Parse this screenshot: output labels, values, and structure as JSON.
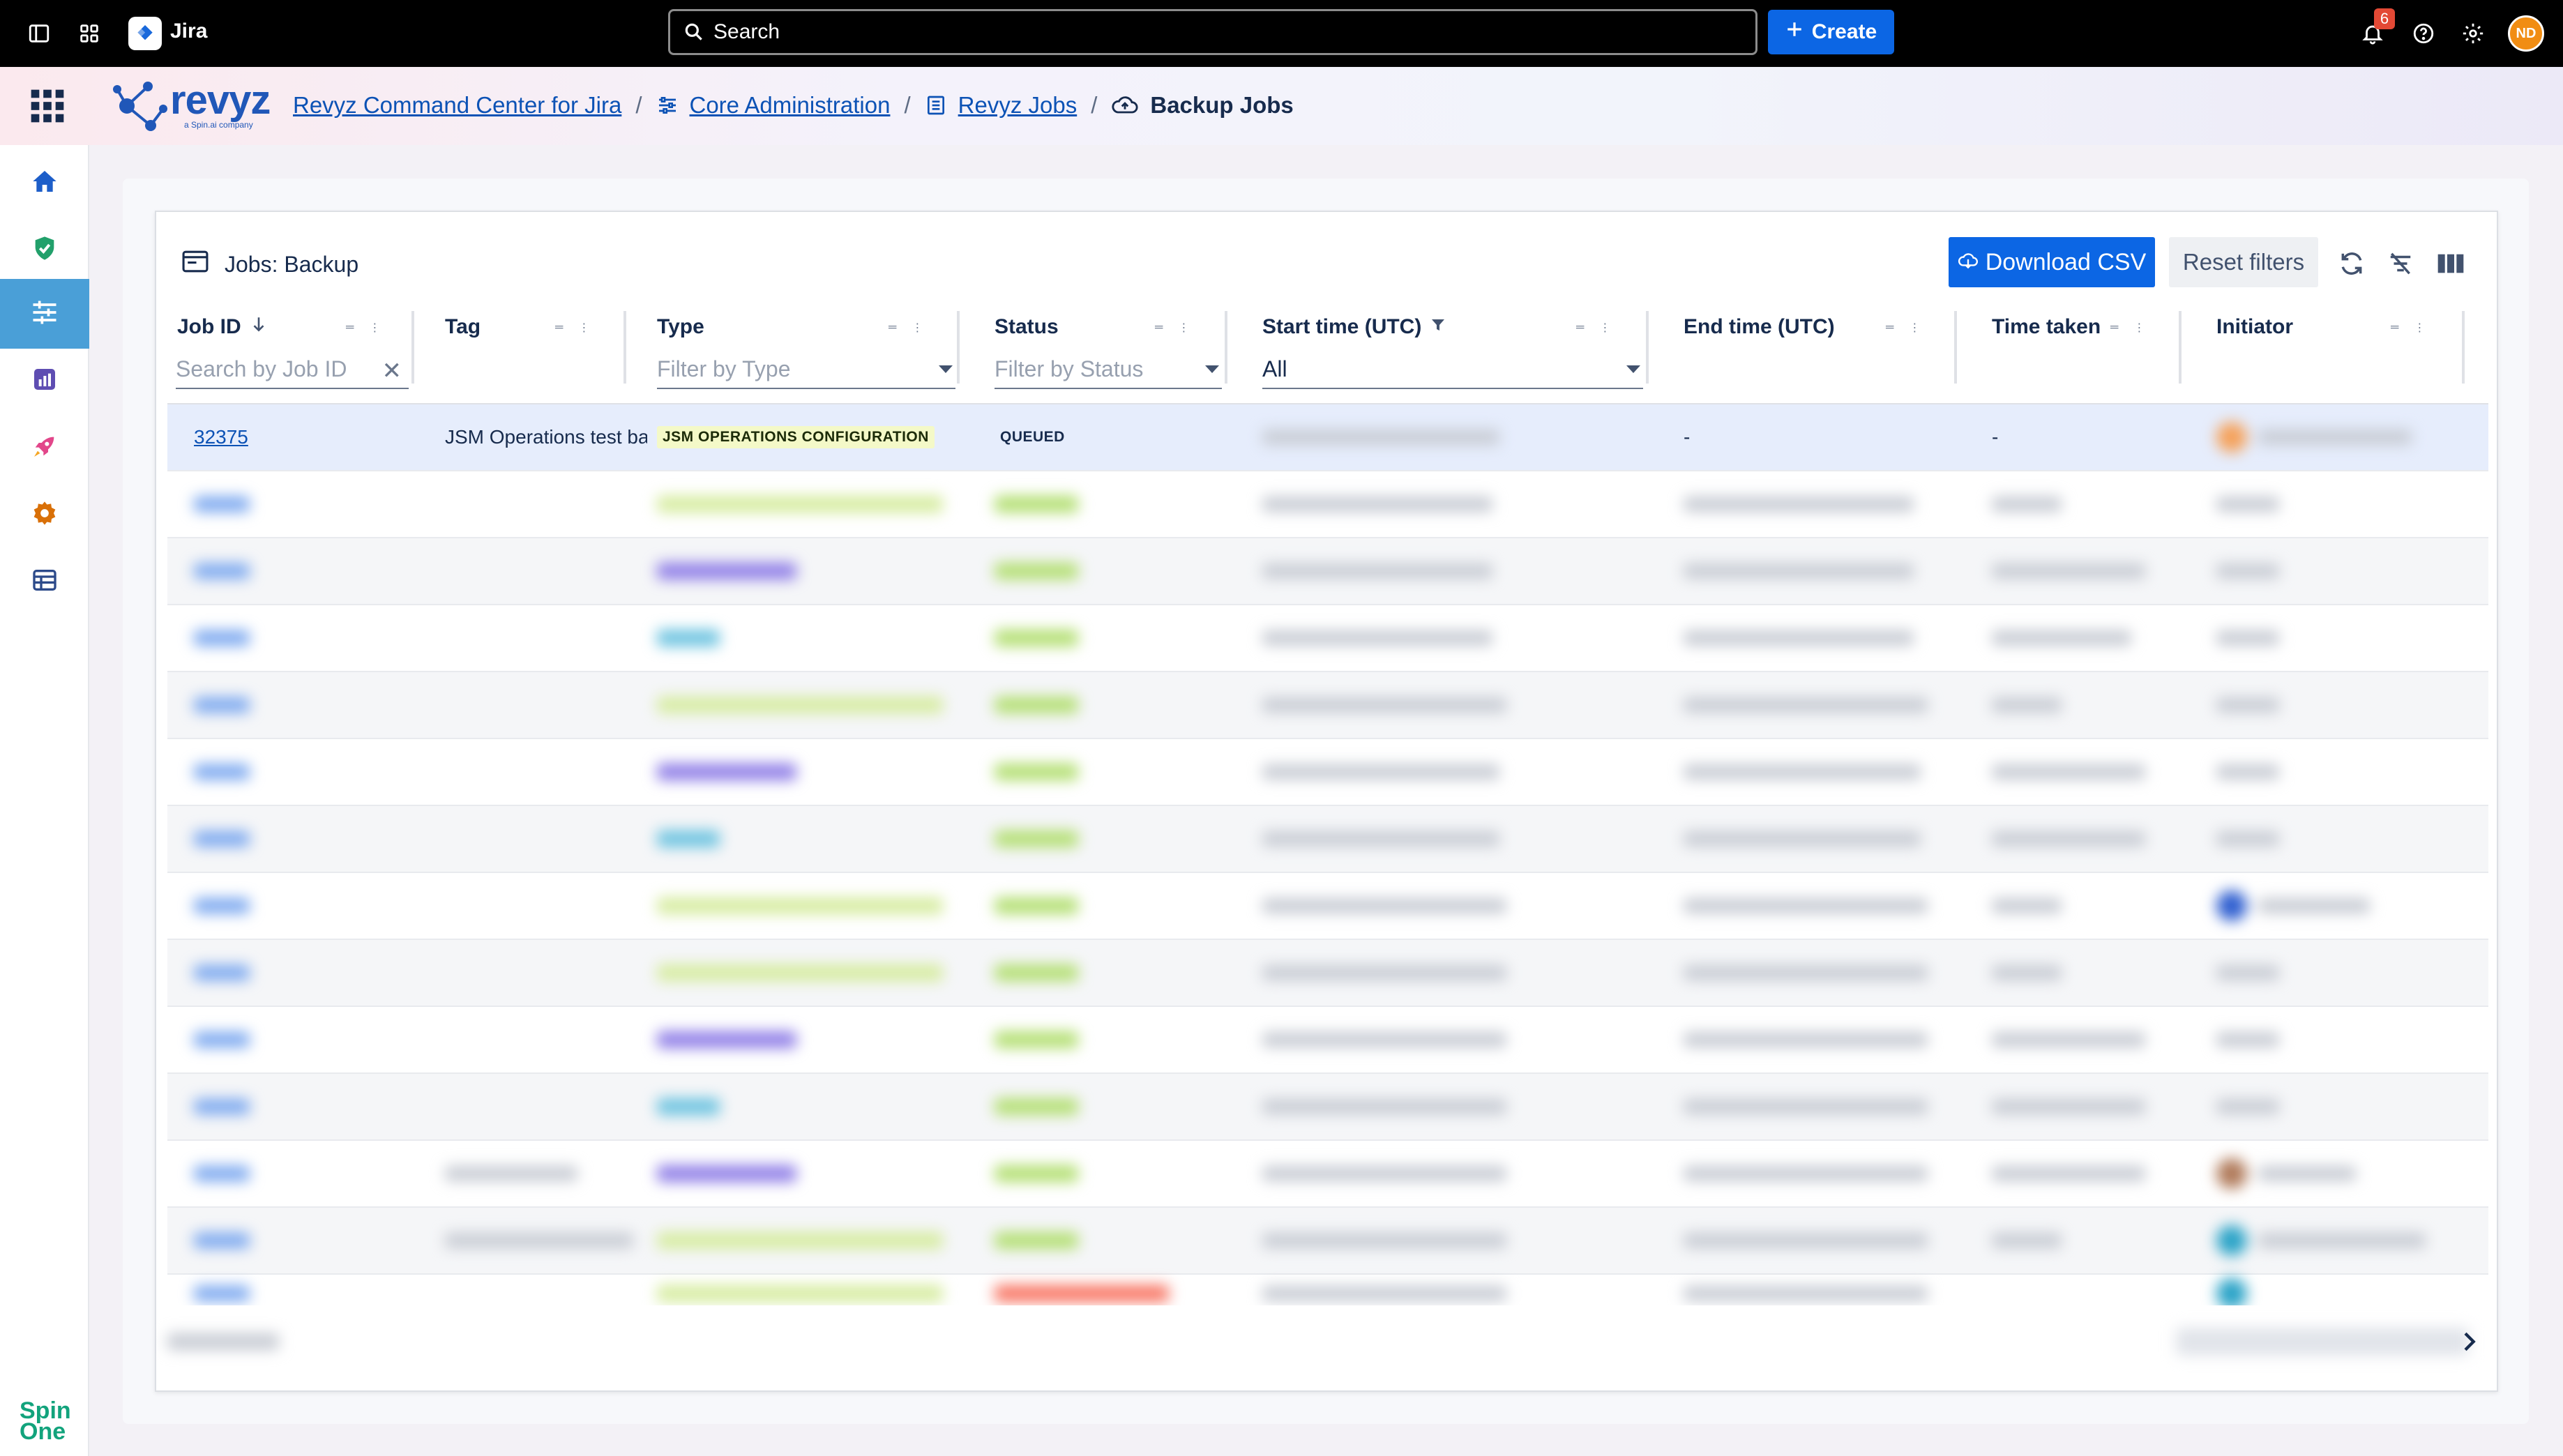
{
  "topbar": {
    "app_name": "Jira",
    "search_placeholder": "Search",
    "create_label": "Create",
    "notification_count": "6",
    "avatar_initials": "ND"
  },
  "header": {
    "brand": "revyz",
    "brand_sub": "a Spin.ai company",
    "breadcrumbs": [
      {
        "label": "Revyz Command Center for Jira",
        "icon": "revyz-icon"
      },
      {
        "label": "Core Administration",
        "icon": "sliders-icon"
      },
      {
        "label": "Revyz Jobs",
        "icon": "list-icon"
      },
      {
        "label": "Backup Jobs",
        "icon": "cloud-backup-icon"
      }
    ]
  },
  "sidebar": {
    "items": [
      {
        "icon": "home-icon"
      },
      {
        "icon": "shield-check-icon"
      },
      {
        "icon": "sliders-icon",
        "active": true
      },
      {
        "icon": "report-icon"
      },
      {
        "icon": "rocket-icon"
      },
      {
        "icon": "gear-icon"
      },
      {
        "icon": "table-icon"
      }
    ],
    "footer_logo_line1": "Spin",
    "footer_logo_line2": "One"
  },
  "card": {
    "title": "Jobs: Backup",
    "download_label": "Download CSV",
    "reset_label": "Reset filters"
  },
  "table": {
    "columns": {
      "job_id": "Job ID",
      "tag": "Tag",
      "type": "Type",
      "status": "Status",
      "start_time": "Start time (UTC)",
      "end_time": "End time (UTC)",
      "time_taken": "Time taken",
      "initiator": "Initiator"
    },
    "filters": {
      "job_id_placeholder": "Search by Job ID",
      "type_placeholder": "Filter by Type",
      "status_placeholder": "Filter by Status",
      "start_time_value": "All"
    },
    "first_row": {
      "job_id": "32375",
      "tag": "JSM Operations test ba",
      "type": "JSM OPERATIONS CONFIGURATION",
      "status": "QUEUED",
      "end_time": "-",
      "time_taken": "-"
    },
    "colors": {
      "jsm": "#f4f9c8",
      "purple": "#8f7ee7",
      "teal": "#6cc3e0",
      "green": "#b3df72",
      "red": "#f87462",
      "link": "#0c52b5"
    }
  }
}
